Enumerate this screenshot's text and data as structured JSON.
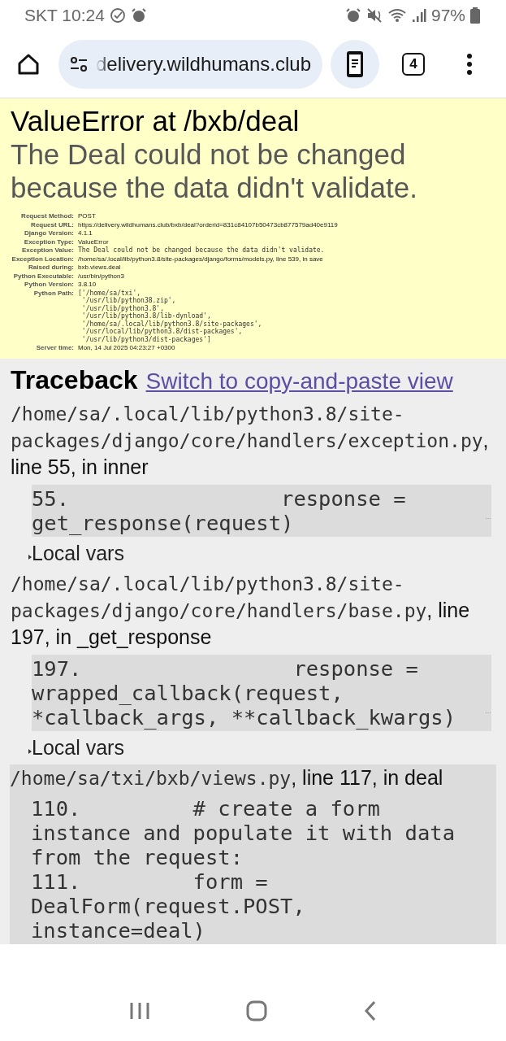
{
  "status_bar": {
    "carrier_time": "SKT 10:24",
    "battery": "97%"
  },
  "browser": {
    "url": "delivery.wildhumans.club",
    "tab_count": "4"
  },
  "summary": {
    "title": "ValueError at /bxb/deal",
    "message": "The Deal could not be changed because the data didn't validate.",
    "meta": [
      {
        "label": "Request Method:",
        "value": "POST",
        "kind": "text"
      },
      {
        "label": "Request URL:",
        "value": "https://delivery.wildhumans.club/bxb/deal?orderid=831c84107b50473cb877579ad40e9119",
        "kind": "text"
      },
      {
        "label": "Django Version:",
        "value": "4.1.1",
        "kind": "text"
      },
      {
        "label": "Exception Type:",
        "value": "ValueError",
        "kind": "text"
      },
      {
        "label": "Exception Value:",
        "value": "The Deal could not be changed because the data didn't validate.",
        "kind": "code"
      },
      {
        "label": "Exception Location:",
        "value": "/home/sa/.local/lib/python3.8/site-packages/django/forms/models.py, line 539, in save",
        "kind": "text"
      },
      {
        "label": "Raised during:",
        "value": "bxb.views.deal",
        "kind": "text"
      },
      {
        "label": "Python Executable:",
        "value": "/usr/bin/python3",
        "kind": "text"
      },
      {
        "label": "Python Version:",
        "value": "3.8.10",
        "kind": "text"
      },
      {
        "label": "Python Path:",
        "value": "['/home/sa/txi',\n '/usr/lib/python38.zip',\n '/usr/lib/python3.8',\n '/usr/lib/python3.8/lib-dynload',\n '/home/sa/.local/lib/python3.8/site-packages',\n '/usr/local/lib/python3.8/dist-packages',\n '/usr/lib/python3/dist-packages']",
        "kind": "code"
      },
      {
        "label": "Server time:",
        "value": "Mon, 14 Jul 2025 04:23:27 +0300",
        "kind": "text"
      }
    ]
  },
  "traceback": {
    "heading": "Traceback",
    "switch_link": "Switch to copy-and-paste view",
    "frames": [
      {
        "kind": "django",
        "file": "/home/sa/.local/lib/python3.8/site-packages/django/core/handlers/exception.py",
        "location": ", line 55, in inner",
        "lines": [
          {
            "number": "55.",
            "code": "                 response = get_response(request)"
          }
        ],
        "ellipsis": "…",
        "local_vars": "Local vars"
      },
      {
        "kind": "django",
        "file": "/home/sa/.local/lib/python3.8/site-packages/django/core/handlers/base.py",
        "location": ", line 197, in _get_response",
        "lines": [
          {
            "number": "197.",
            "code": "                 response = wrapped_callback(request, *callback_args, **callback_kwargs)"
          }
        ],
        "ellipsis": "…",
        "local_vars": "Local vars"
      },
      {
        "kind": "user",
        "file": "/home/sa/txi/bxb/views.py",
        "location": ", line 117, in deal",
        "lines": [
          {
            "number": "110.",
            "code": "         # create a form instance and populate it with data from the request:"
          },
          {
            "number": "111.",
            "code": "         form = DealForm(request.POST, instance=deal)"
          }
        ]
      }
    ]
  }
}
